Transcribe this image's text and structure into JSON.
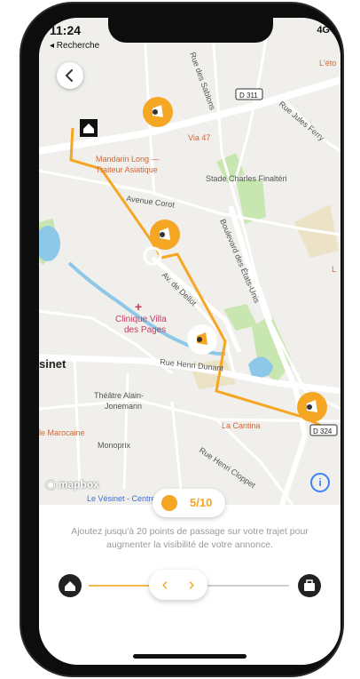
{
  "status": {
    "time": "11:24",
    "back_label": "◂ Recherche",
    "network": "4G"
  },
  "map": {
    "labels": {
      "rue_sablons": "Rue des Sablons",
      "d311": "D 311",
      "rue_jules_ferry": "Rue Jules Ferry",
      "l_eto": "L'éto",
      "via47": "Via 47",
      "mandarin": "Mandarin Long —",
      "traiteur": "Traiteur Asiatique",
      "stade": "Stade Charles Finaltéri",
      "avenue_corot": "Avenue Corot",
      "bd_etats_unis": "Boulevard des États-Unis",
      "av_dellot": "Av. de Dellot",
      "clinique1": "Clinique Villa",
      "clinique2": "des Pages",
      "sinet": "sinet",
      "rue_henri_dunant": "Rue Henri Dunant",
      "theatre1": "Théâtre Alain-",
      "theatre2": "Jonemann",
      "marocaine": "le Marocaine",
      "monoprix": "Monoprix",
      "la_cantina": "La Cantina",
      "d324": "D 324",
      "rue_henri_cloppet": "Rue Henri Cloppet",
      "le_vesinet": "Le Vésinet - Centre",
      "l_right": "L",
      "mapbox": "mapbox"
    }
  },
  "counter": {
    "value": "5/10"
  },
  "helper_text": "Ajoutez jusqu'à 20 points de passage sur votre trajet pour augmenter la visibilité de votre annonce.",
  "stepper": {
    "prev": "‹",
    "next": "›"
  },
  "info": "i",
  "colors": {
    "accent": "#f5a623",
    "route": "#f5a623",
    "park": "#c8e6b0",
    "water": "#8ec8e8"
  }
}
